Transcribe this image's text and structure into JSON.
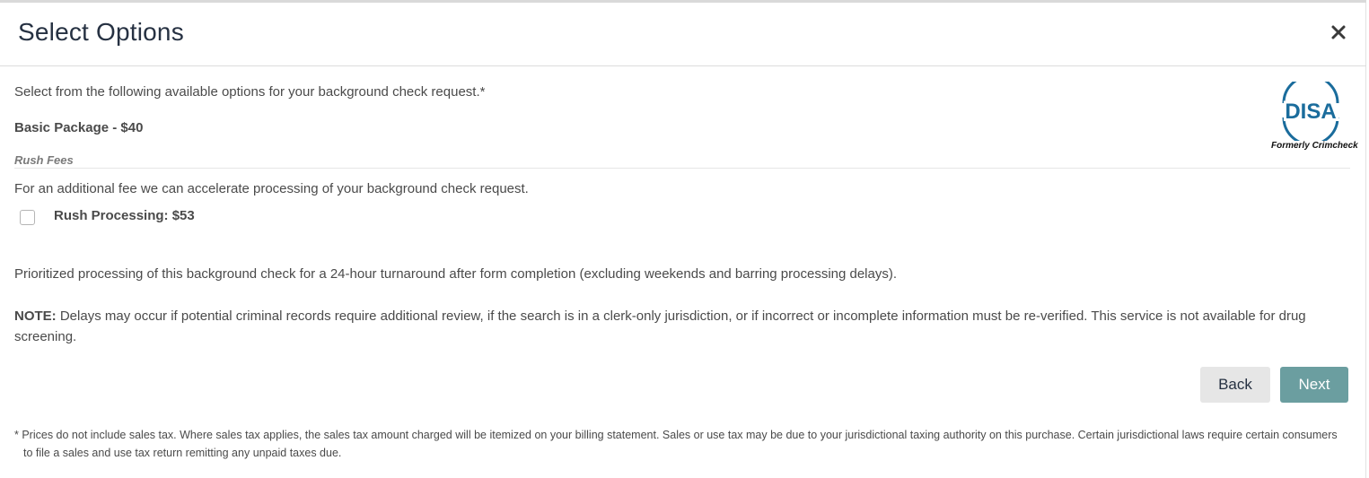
{
  "dialog": {
    "title": "Select Options",
    "close_icon": "close-icon"
  },
  "intro": "Select from the following available options for your background check request.*",
  "package": "Basic Package - $40",
  "logo": {
    "text": "DISA",
    "caption": "Formerly Crimcheck",
    "color": "#1a6c9c"
  },
  "rush": {
    "section_label": "Rush Fees",
    "description": "For an additional fee we can accelerate processing of your background check request.",
    "option_label": "Rush Processing: $53",
    "checked": false,
    "detail": "Prioritized processing of this background check for a 24-hour turnaround after form completion (excluding weekends and barring processing delays).",
    "note_label": "NOTE:",
    "note_text": " Delays may occur if potential criminal records require additional review, if the search is in a clerk-only jurisdiction, or if incorrect or incomplete information must be re-verified. This service is not available for drug screening."
  },
  "buttons": {
    "back": "Back",
    "next": "Next"
  },
  "footnote": "* Prices do not include sales tax. Where sales tax applies, the sales tax amount charged will be itemized on your billing statement. Sales or use tax may be due to your jurisdictional taxing authority on this purchase. Certain jurisdictional laws require certain consumers to file a sales and use tax return remitting any unpaid taxes due.",
  "colors": {
    "title": "#263142",
    "text": "#4a4a4a",
    "next_button": "#6b9ea0",
    "back_button": "#e6e6e6"
  }
}
